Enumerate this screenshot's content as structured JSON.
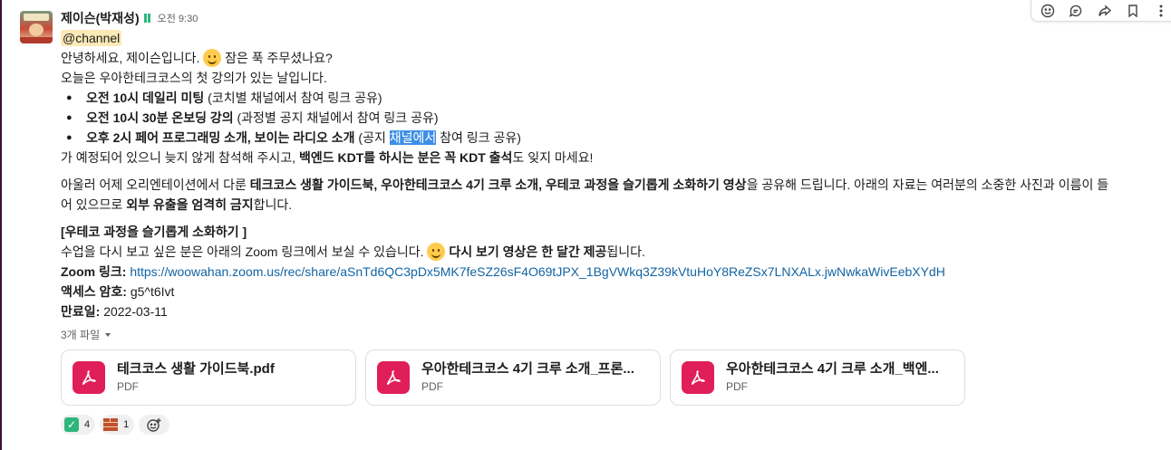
{
  "message": {
    "sender": "제이슨(박재성)",
    "time": "오전 9:30",
    "mention": "@channel",
    "greeting_a": "안녕하세요, 제이슨입니다.",
    "greeting_b": "잠은 푹 주무셨나요?",
    "intro": "오늘은 우아한테크코스의 첫 강의가 있는 날입니다.",
    "bullets": [
      {
        "bold": "오전 10시 데일리 미팅",
        "rest": " (코치별 채널에서 참여 링크 공유)"
      },
      {
        "bold": "오전 10시 30분 온보딩 강의",
        "rest": " (과정별 공지 채널에서 참여 링크 공유)"
      },
      {
        "bold": "오후 2시 페어 프로그래밍 소개, 보이는 라디오 소개",
        "rest_a": " (공지 ",
        "highlight": "채널에서",
        "rest_b": " 참여 링크 공유)"
      }
    ],
    "reminder_a": "가 예정되어 있으니 늦지 않게 참석해 주시고, ",
    "reminder_bold": "백엔드 KDT를 하시는 분은 꼭 KDT 출석",
    "reminder_b": "도 잊지 마세요!",
    "p2_a": "아울러 어제 오리엔테이션에서 다룬 ",
    "p2_bold1": "테크코스 생활 가이드북, 우아한테크코스 4기 크루 소개, 우테코 과정을 슬기롭게 소화하기 영상",
    "p2_b": "을 공유해 드립니다. 아래의 자료는 여러분의 소중한 사진과 이름이 들",
    "p2_c": "어 있으므로 ",
    "p2_bold2": "외부 유출을 엄격히 금지",
    "p2_d": "합니다.",
    "section_title": "[우테코 과정을 슬기롭게 소화하기 ]",
    "zoom_text_a": "수업을 다시 보고 싶은 분은 아래의 Zoom 링크에서 보실 수 있습니다.",
    "zoom_bold": "다시 보기 영상은 한 달간 제공",
    "zoom_text_b": "됩니다.",
    "zoom_link_label": "Zoom 링크:",
    "zoom_link_url": "https://woowahan.zoom.us/rec/share/aSnTd6QC3pDx5MK7feSZ26sF4O69tJPX_1BgVWkq3Z39kVtuHoY8ReZSx7LNXALx.jwNwkaWivEebXYdH",
    "access_label": "액세스 암호:",
    "access_value": " g5^t6Ivt",
    "expiry_label": "만료일:",
    "expiry_value": " 2022-03-11"
  },
  "files": {
    "label": "3개 파일",
    "items": [
      {
        "name": "테크코스 생활 가이드북.pdf",
        "type": "PDF"
      },
      {
        "name": "우아한테크코스 4기 크루 소개_프론...",
        "type": "PDF"
      },
      {
        "name": "우아한테크코스 4기 크루 소개_백엔...",
        "type": "PDF"
      }
    ]
  },
  "reactions": [
    {
      "icon": "check-mark-icon",
      "count": "4"
    },
    {
      "icon": "brick-icon",
      "count": "1"
    }
  ],
  "toolbar": [
    "emoji-reaction-icon",
    "reply-thread-icon",
    "share-icon",
    "bookmark-icon",
    "more-icon"
  ],
  "colors": {
    "accent_link": "#1264a3",
    "mention_bg": "#fbe9b7",
    "pdf_red": "#e01e5a",
    "selection": "#3c8ee6"
  }
}
